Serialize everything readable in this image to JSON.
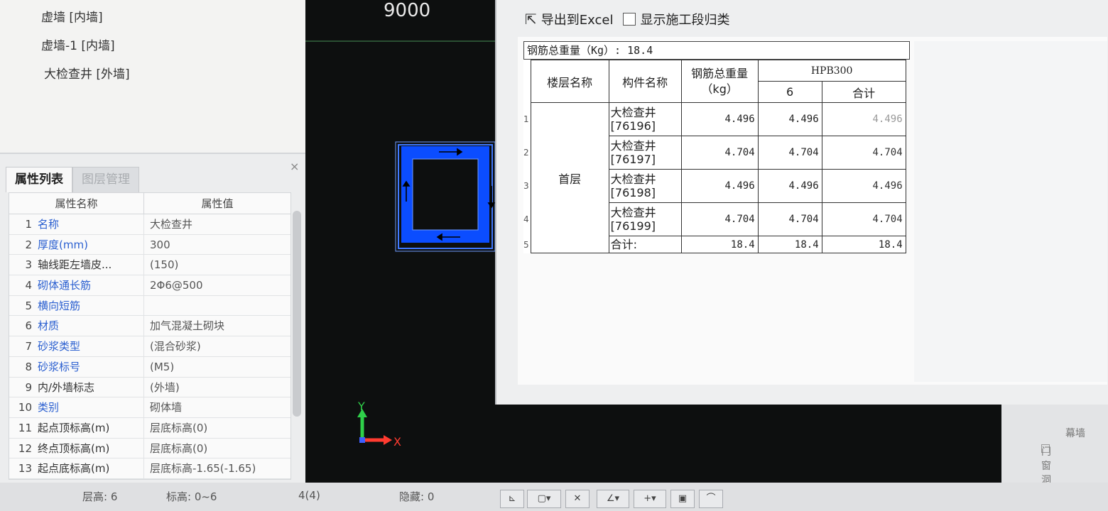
{
  "canvas": {
    "label": "9000"
  },
  "component_list": {
    "items": [
      "虚墙 [内墙]",
      "虚墙-1 [内墙]",
      "大检查井 [外墙]"
    ]
  },
  "properties": {
    "tabs": [
      "属性列表",
      "图层管理"
    ],
    "headers": {
      "name": "属性名称",
      "value": "属性值"
    },
    "rows": [
      {
        "num": "1",
        "name": "名称",
        "value": "大检查井",
        "blue": true
      },
      {
        "num": "2",
        "name": "厚度(mm)",
        "value": "300",
        "blue": true
      },
      {
        "num": "3",
        "name": "轴线距左墙皮...",
        "value": "(150)",
        "blue": false
      },
      {
        "num": "4",
        "name": "砌体通长筋",
        "value": "2Φ6@500",
        "blue": true
      },
      {
        "num": "5",
        "name": "横向短筋",
        "value": "",
        "blue": true
      },
      {
        "num": "6",
        "name": "材质",
        "value": "加气混凝土砌块",
        "blue": true
      },
      {
        "num": "7",
        "name": "砂浆类型",
        "value": "(混合砂浆)",
        "blue": true
      },
      {
        "num": "8",
        "name": "砂浆标号",
        "value": "(M5)",
        "blue": true
      },
      {
        "num": "9",
        "name": "内/外墙标志",
        "value": "(外墙)",
        "blue": false
      },
      {
        "num": "10",
        "name": "类别",
        "value": "砌体墙",
        "blue": true
      },
      {
        "num": "11",
        "name": "起点顶标高(m)",
        "value": "层底标高(0)",
        "blue": false
      },
      {
        "num": "12",
        "name": "终点顶标高(m)",
        "value": "层底标高(0)",
        "blue": false
      },
      {
        "num": "13",
        "name": "起点底标高(m)",
        "value": "层底标高-1.65(-1.65)",
        "blue": false
      }
    ]
  },
  "status": {
    "floor_height": "层高:  6",
    "elevation": "标高:  0~6",
    "count": "4(4)",
    "hidden": "隐藏:  0"
  },
  "dialog": {
    "export_label": "导出到Excel",
    "show_stage_label": "显示施工段归类",
    "total_weight_line": "钢筋总重量（Kg）: 18.4",
    "headers": {
      "floor": "楼层名称",
      "component": "构件名称",
      "total_weight": "钢筋总重量（kg）",
      "grade": "HPB300",
      "dia": "6",
      "sum": "合计"
    },
    "floor_name": "首层",
    "rows": [
      {
        "idx": "1",
        "component": "大检查井[76196]",
        "total": "4.496",
        "d6": "4.496",
        "sum": "4.496"
      },
      {
        "idx": "2",
        "component": "大检查井[76197]",
        "total": "4.704",
        "d6": "4.704",
        "sum": "4.704"
      },
      {
        "idx": "3",
        "component": "大检查井[76198]",
        "total": "4.496",
        "d6": "4.496",
        "sum": "4.496"
      },
      {
        "idx": "4",
        "component": "大检查井[76199]",
        "total": "4.704",
        "d6": "4.704",
        "sum": "4.704"
      }
    ],
    "total_row": {
      "idx": "5",
      "label": "合计:",
      "total": "18.4",
      "d6": "18.4",
      "sum": "18.4"
    }
  },
  "right_panel": {
    "items": [
      "幕墙",
      "门窗洞"
    ]
  },
  "axis": {
    "y": "Y",
    "x": "X"
  }
}
